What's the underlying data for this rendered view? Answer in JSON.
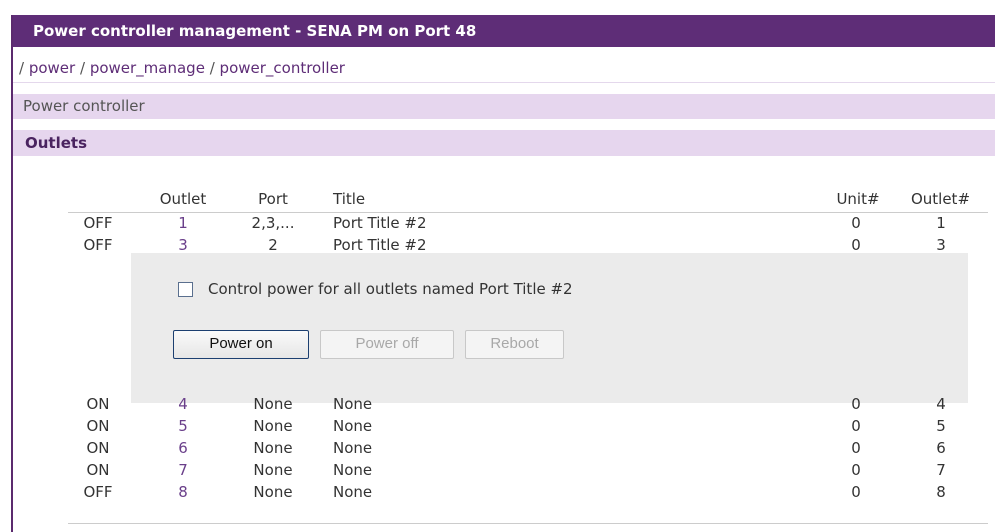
{
  "header": {
    "title": "Power controller management - SENA PM on Port 48"
  },
  "breadcrumb": {
    "parts": [
      "power",
      "power_manage",
      "power_controller"
    ],
    "sep": "/"
  },
  "sections": {
    "power_controller": "Power controller",
    "outlets": "Outlets"
  },
  "table": {
    "headers": {
      "outlet": "Outlet",
      "port": "Port",
      "title": "Title",
      "unit": "Unit#",
      "outlet_num": "Outlet#"
    },
    "rows": [
      {
        "status": "OFF",
        "outlet": "1",
        "port": "2,3,...",
        "title": "Port Title #2",
        "unit": "0",
        "outlet_num": "1"
      },
      {
        "status": "OFF",
        "outlet": "3",
        "port": "2",
        "title": "Port Title #2",
        "unit": "0",
        "outlet_num": "3"
      },
      {
        "status": "ON",
        "outlet": "4",
        "port": "None",
        "title": "None",
        "unit": "0",
        "outlet_num": "4"
      },
      {
        "status": "ON",
        "outlet": "5",
        "port": "None",
        "title": "None",
        "unit": "0",
        "outlet_num": "5"
      },
      {
        "status": "ON",
        "outlet": "6",
        "port": "None",
        "title": "None",
        "unit": "0",
        "outlet_num": "6"
      },
      {
        "status": "ON",
        "outlet": "7",
        "port": "None",
        "title": "None",
        "unit": "0",
        "outlet_num": "7"
      },
      {
        "status": "OFF",
        "outlet": "8",
        "port": "None",
        "title": "None",
        "unit": "0",
        "outlet_num": "8"
      }
    ]
  },
  "panel": {
    "checkbox_label": "Control power for all outlets named Port Title #2",
    "buttons": {
      "power_on": "Power on",
      "power_off": "Power off",
      "reboot": "Reboot"
    }
  },
  "colors": {
    "header_bg": "#5e2d77",
    "section_bg": "#e6d6ee",
    "panel_bg": "#ebebeb",
    "link": "#6a3f8a"
  }
}
